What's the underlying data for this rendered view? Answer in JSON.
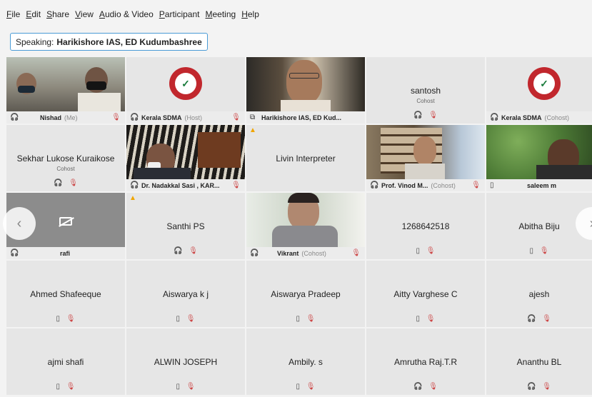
{
  "menu": [
    "File",
    "Edit",
    "Share",
    "View",
    "Audio & Video",
    "Participant",
    "Meeting",
    "Help"
  ],
  "speaking": {
    "prefix": "Speaking:",
    "name": "Harikishore IAS, ED Kudumbashree"
  },
  "tiles": {
    "nishad": {
      "name": "Nishad",
      "role": "(Me)"
    },
    "kerala_host": {
      "name": "Kerala SDMA",
      "role": "(Host)"
    },
    "harikishore": {
      "name": "Harikishore IAS, ED Kud..."
    },
    "santosh": {
      "name": "santosh",
      "sub": "Cohost"
    },
    "kerala_cohost": {
      "name": "Kerala SDMA",
      "role": "(Cohost)"
    },
    "sekhar": {
      "name": "Sekhar Lukose Kuraikose",
      "sub": "Cohost"
    },
    "nadakkal": {
      "name": "Dr. Nadakkal Sasi , KAR..."
    },
    "livin": {
      "name": "Livin Interpreter"
    },
    "vinod": {
      "name": "Prof. Vinod M...",
      "role": "(Cohost)"
    },
    "saleem": {
      "name": "saleem m"
    },
    "rafi": {
      "name": "rafi"
    },
    "santhi": {
      "name": "Santhi PS"
    },
    "vikrant": {
      "name": "Vikrant",
      "role": "(Cohost)"
    },
    "num": {
      "name": "1268642518"
    },
    "abitha": {
      "name": "Abitha Biju"
    },
    "ahmed": {
      "name": "Ahmed Shafeeque"
    },
    "aiswarya_k": {
      "name": "Aiswarya k j"
    },
    "aiswarya_p": {
      "name": "Aiswarya Pradeep"
    },
    "aitty": {
      "name": "Aitty Varghese C"
    },
    "ajesh": {
      "name": "ajesh"
    },
    "ajmi": {
      "name": "ajmi shafi"
    },
    "alwin": {
      "name": "ALWIN JOSEPH"
    },
    "ambily": {
      "name": "Ambily. s"
    },
    "amrutha": {
      "name": "Amrutha Raj.T.R"
    },
    "ananthu": {
      "name": "Ananthu BL"
    }
  },
  "icons": {
    "mic_muted": "🎙",
    "headset": "🎧",
    "phone": "▯",
    "warning": "▲",
    "screen": "⧉"
  },
  "nav": {
    "prev": "‹",
    "next": "›"
  }
}
